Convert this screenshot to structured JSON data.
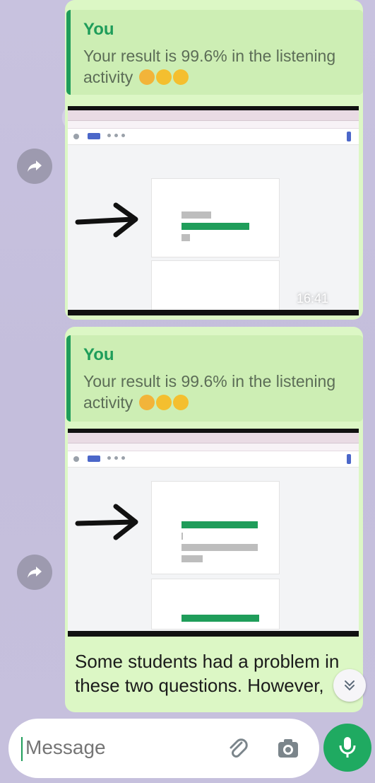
{
  "messages": [
    {
      "quote_author": "You",
      "quote_text": "Your result is 99.6% in the listening activity",
      "timestamp": "16:41"
    },
    {
      "quote_author": "You",
      "quote_text": "Your result is 99.6% in the listening activity",
      "body": "Some students had a problem in these two questions. However,"
    }
  ],
  "composer": {
    "placeholder": "Message"
  },
  "icons": {
    "forward": "forward-icon",
    "attach": "paperclip-icon",
    "camera": "camera-icon",
    "mic": "microphone-icon",
    "scroll": "double-chevron-down-icon"
  },
  "colors": {
    "bubble": "#dcf7c5",
    "accent": "#1f9d5a",
    "mic": "#1faa61",
    "wallpaper": "#c9c4e0"
  }
}
